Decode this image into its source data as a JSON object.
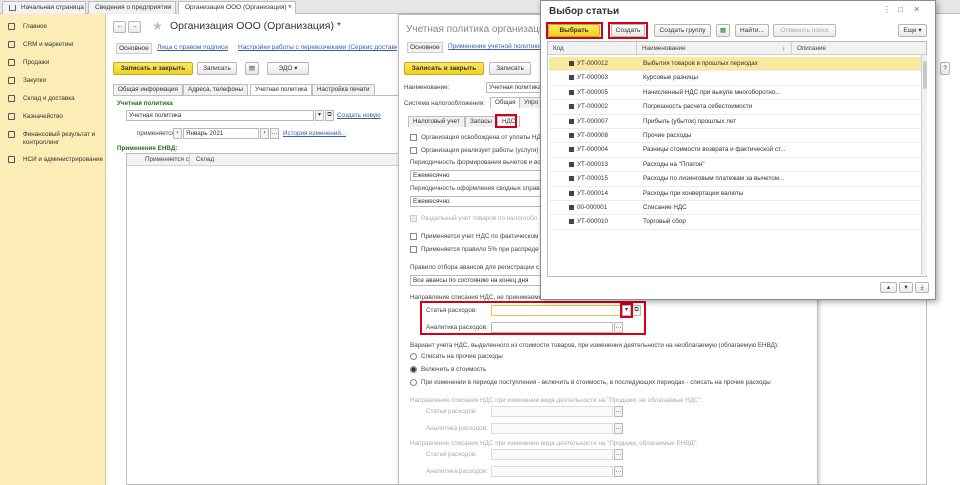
{
  "tabs": [
    {
      "label": "Начальная страница"
    },
    {
      "label": "Сведения о предприятии"
    },
    {
      "label": "Организация ООО (Организация) *"
    }
  ],
  "sidebar": {
    "items": [
      {
        "label": "Главное"
      },
      {
        "label": "CRM и маркетинг"
      },
      {
        "label": "Продажи"
      },
      {
        "label": "Закупки"
      },
      {
        "label": "Склад и доставка"
      },
      {
        "label": "Казначейство"
      },
      {
        "label": "Финансовый результат и контроллинг"
      },
      {
        "label": "НСИ и администрирование"
      }
    ]
  },
  "org": {
    "title": "Организация ООО (Организация) *",
    "nav": [
      "Основное",
      "Лица с правом подписи",
      "Настройки работы с перевозчиками (Сервис доставк"
    ],
    "save_close": "Записать и закрыть",
    "save": "Записать",
    "edo": "ЭДО",
    "tabs": [
      "Общая информация",
      "Адреса, телефоны",
      "Учетная политика",
      "Настройка печати"
    ],
    "policy_caption": "Учетная политика",
    "policy_value": "Учетная политика",
    "create_new": "Создать новую",
    "applies_from": "применяется с:",
    "applies_value": "Январь 2021",
    "history": "История изменений...",
    "envd": "Применение ЕНВД:",
    "grid_cols": [
      "Применяется с",
      "Склад"
    ]
  },
  "policy": {
    "title": "Учетная политика организаций (",
    "nav": [
      "Основное",
      "Применение учетной политики"
    ],
    "save_close": "Записать и закрыть",
    "save": "Записать",
    "name_label": "Наименование:",
    "name_value": "Учетная политика",
    "tax_label": "Система налогообложения:",
    "tax_tabs": [
      "Общая",
      "Упро"
    ],
    "sub_tabs": [
      "Налоговый учет",
      "Запасы",
      "НДС"
    ],
    "checks": [
      {
        "label": "Организация освобождена от уплаты НДС"
      },
      {
        "label": "Организация реализует работы (услуги)"
      }
    ],
    "period_deduct": "Периодичность формирования вычетов и во",
    "period_deduct_value": "Ежемесячно",
    "period_docs": "Периодичность оформления сводных справ",
    "period_docs_value": "Ежемесячно",
    "checks2": [
      {
        "label": "Раздельный учет товаров по налогообл"
      },
      {
        "label": "Применяется учет НДС по фактическом"
      },
      {
        "label": "Применяется правило 5% при распреде"
      }
    ],
    "advance_rule": "Правило отбора авансов для регистрации с",
    "advance_value": "Все авансы по состоянию на конец дня",
    "direction": "Направление списания НДС, не принимаемого к вычету:",
    "expense_item": "Статья расходов:",
    "expense_analytics": "Аналитика расходов:",
    "variant": "Вариант учета НДС, выделенного из стоимости товаров, при изменении деятельности на необлагаемую (облагаемую ЕНВД):",
    "radios": [
      {
        "label": "Списать на прочие расходы"
      },
      {
        "label": "Включить в стоимость"
      },
      {
        "label": "При изменении в периоде поступления - включить в стоимость, в последующих периодах - списать на прочие расходы"
      }
    ],
    "dir_nontax": "Направление списания НДС при изменении вида деятельности на \"Продажи, не облагаемые НДС\":",
    "dir_envd": "Направление списания НДС при изменении вида деятельности на \"Продажи, облагаемые ЕНВД\":"
  },
  "dialog": {
    "title": "Выбор статьи",
    "select": "Выбрать",
    "create": "Создать",
    "create_group": "Создать группу",
    "find": "Найти...",
    "cancel_search": "Отменить поиск",
    "more": "Еще",
    "columns": [
      "Код",
      "Наименование",
      "Описание"
    ],
    "rows": [
      {
        "code": "УТ-000012",
        "name": "Выбытия товаров в прошлых периодах",
        "selected": true
      },
      {
        "code": "УТ-000003",
        "name": "Курсовые разницы"
      },
      {
        "code": "УТ-000005",
        "name": "Начисленный НДС при выкупе многоборотно..."
      },
      {
        "code": "УТ-000002",
        "name": "Погрешность расчета себестоимости"
      },
      {
        "code": "УТ-000007",
        "name": "Прибыль (убыток) прошлых лет"
      },
      {
        "code": "УТ-000008",
        "name": "Прочие расходы"
      },
      {
        "code": "УТ-000004",
        "name": "Разницы стоимости возврата и фактической ст..."
      },
      {
        "code": "УТ-000013",
        "name": "Расходы на \"Платон\""
      },
      {
        "code": "УТ-000015",
        "name": "Расходы по лизинговым платежам за вычетом..."
      },
      {
        "code": "УТ-000014",
        "name": "Расходы при конвертации валюты"
      },
      {
        "code": "00-000001",
        "name": "Списание НДС"
      },
      {
        "code": "УТ-000010",
        "name": "Торговый сбор"
      }
    ]
  }
}
